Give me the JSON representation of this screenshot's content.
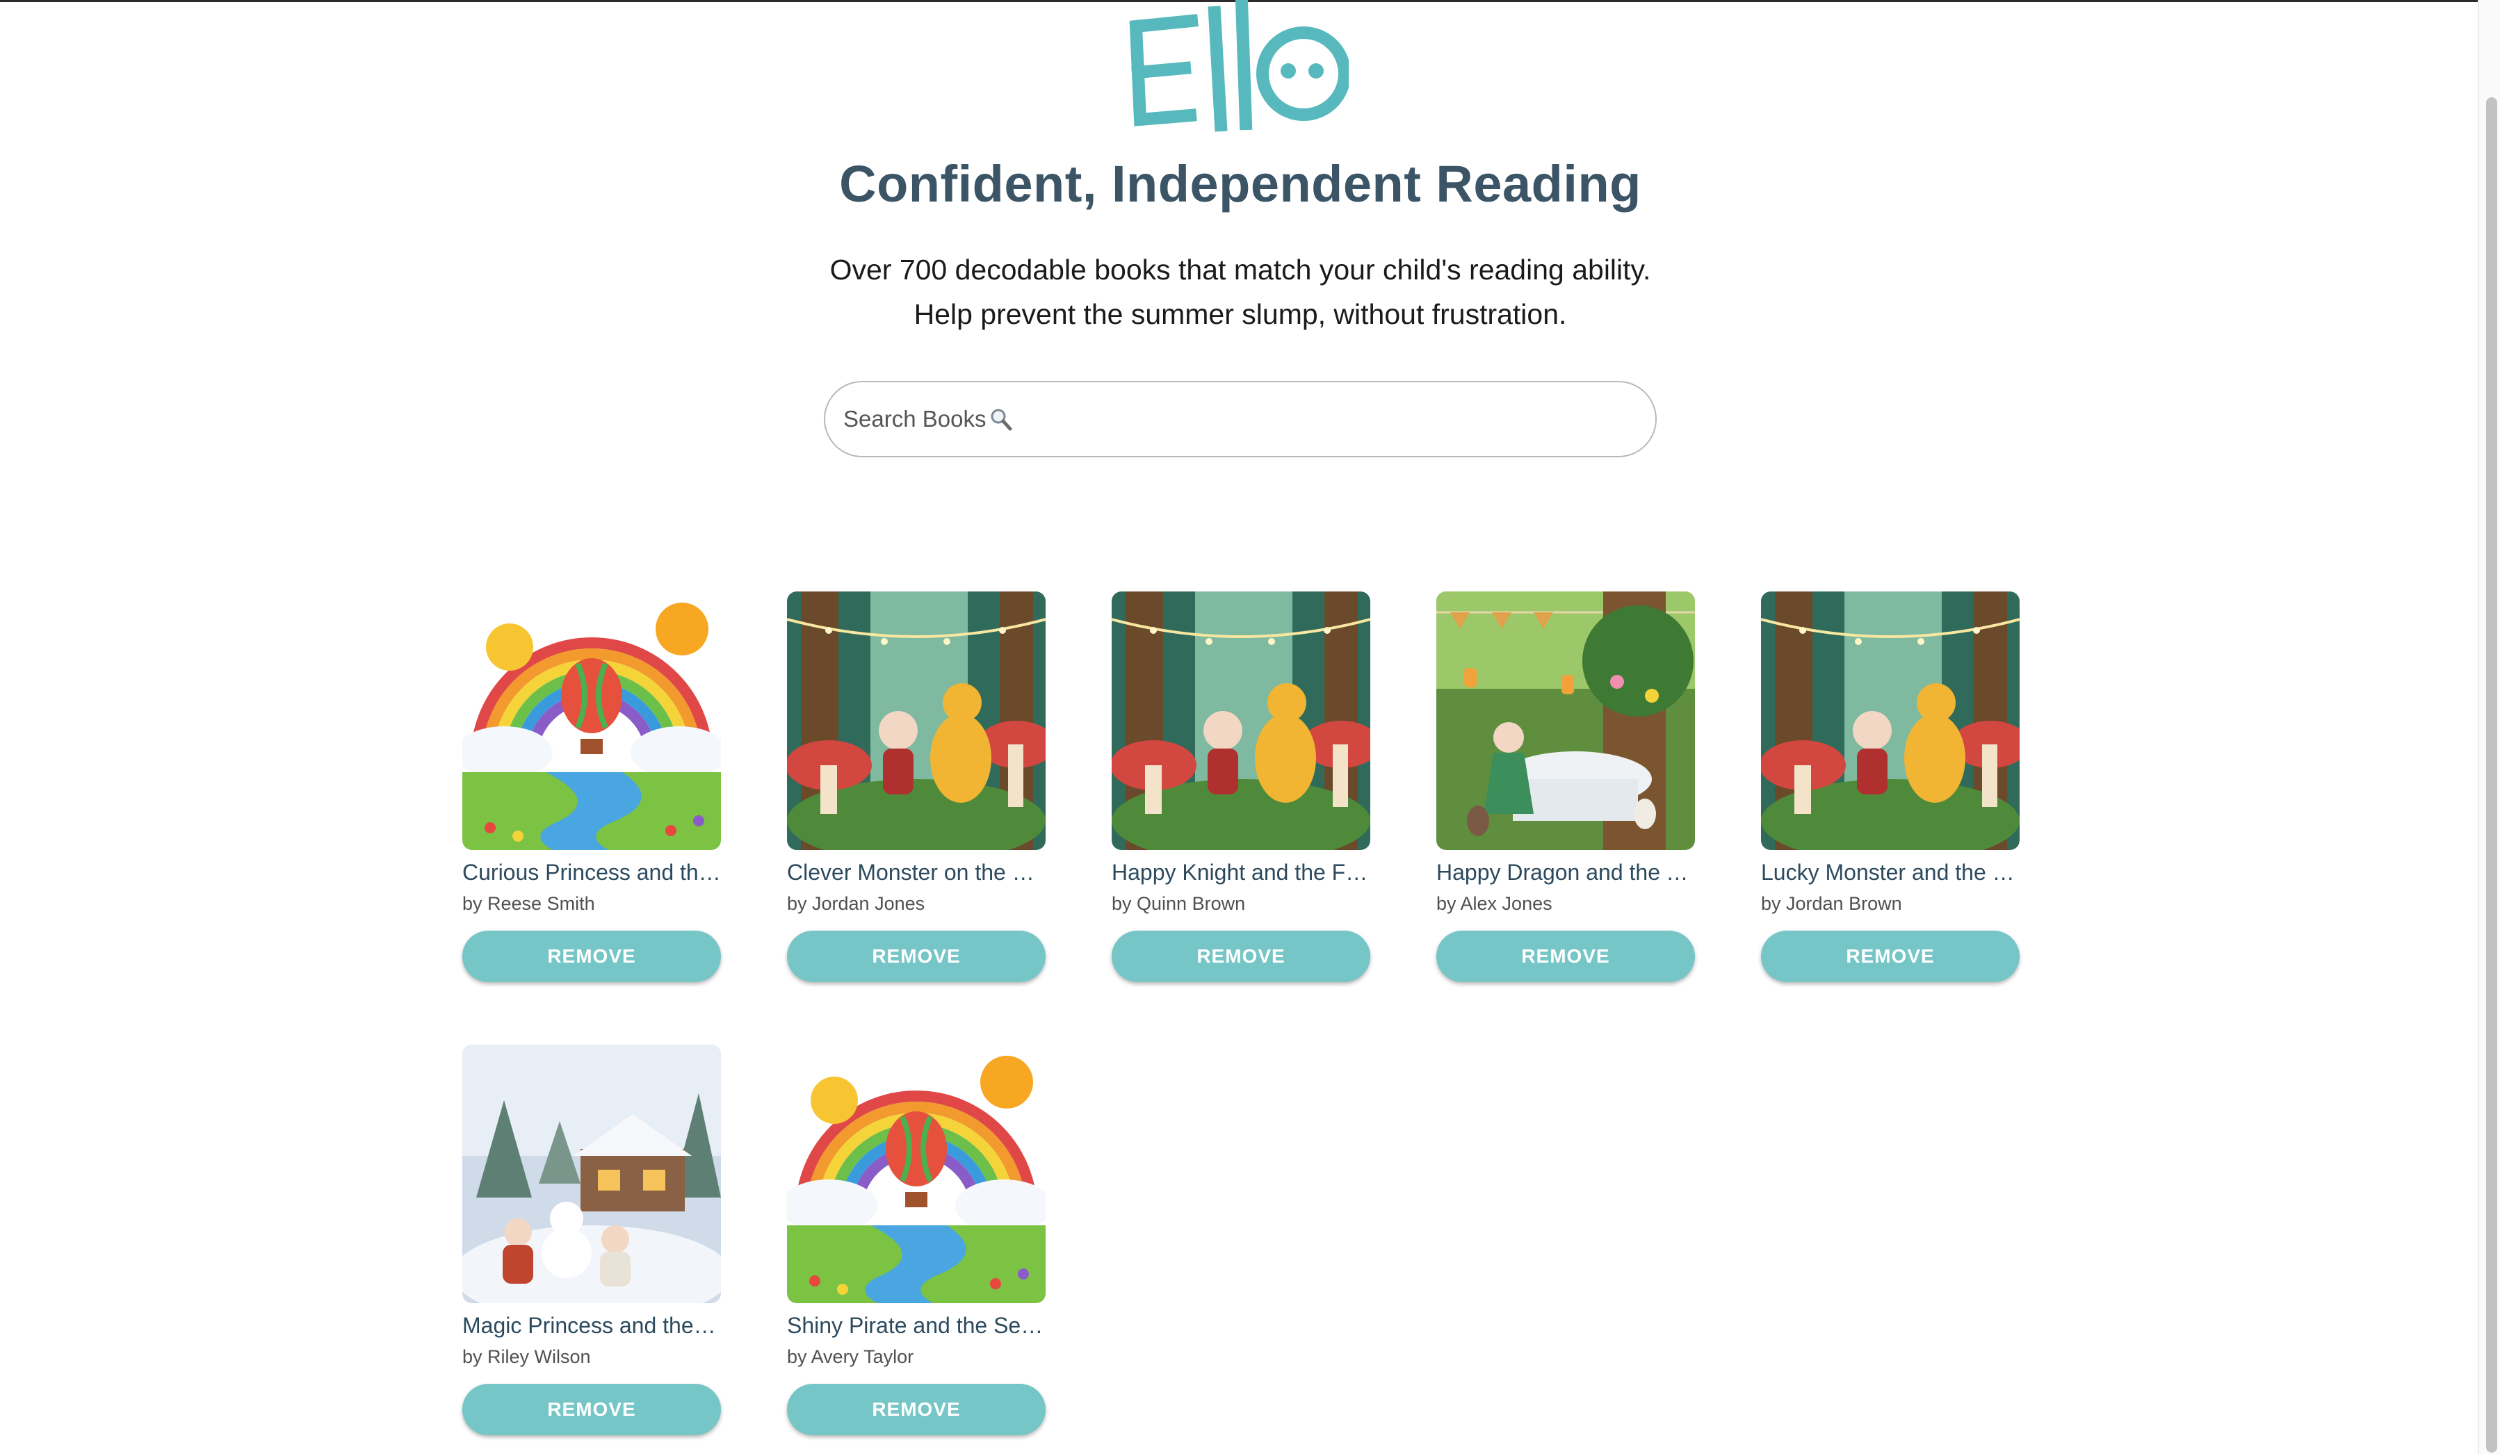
{
  "brand": {
    "logo_text": "Ello",
    "logo_color": "#57b9bd"
  },
  "hero": {
    "title": "Confident, Independent Reading",
    "subtitle_line1": "Over 700 decodable books that match your child's reading ability.",
    "subtitle_line2": "Help prevent the summer slump, without frustration."
  },
  "search": {
    "placeholder": "Search Books",
    "icon": "magnifier-icon"
  },
  "books": [
    {
      "title": "Curious Princess and the Rainbow Balloon",
      "author": "by Reese Smith",
      "remove_label": "REMOVE",
      "cover": "rainbow-balloon"
    },
    {
      "title": "Clever Monster on the Forest Path",
      "author": "by Jordan Jones",
      "remove_label": "REMOVE",
      "cover": "forest-dragon"
    },
    {
      "title": "Happy Knight and the Forest Friend",
      "author": "by Quinn Brown",
      "remove_label": "REMOVE",
      "cover": "forest-dragon"
    },
    {
      "title": "Happy Dragon and the Tea Party",
      "author": "by Alex Jones",
      "remove_label": "REMOVE",
      "cover": "tea-party"
    },
    {
      "title": "Lucky Monster and the Mushroom Forest",
      "author": "by Jordan Brown",
      "remove_label": "REMOVE",
      "cover": "forest-dragon"
    },
    {
      "title": "Magic Princess and the Snowy Day",
      "author": "by Riley Wilson",
      "remove_label": "REMOVE",
      "cover": "snow-day"
    },
    {
      "title": "Shiny Pirate and the Secret Rainbow",
      "author": "by Avery Taylor",
      "remove_label": "REMOVE",
      "cover": "rainbow-balloon"
    }
  ],
  "colors": {
    "accent": "#76c6c8",
    "title": "#3b5466",
    "link": "#2c4a5e"
  }
}
